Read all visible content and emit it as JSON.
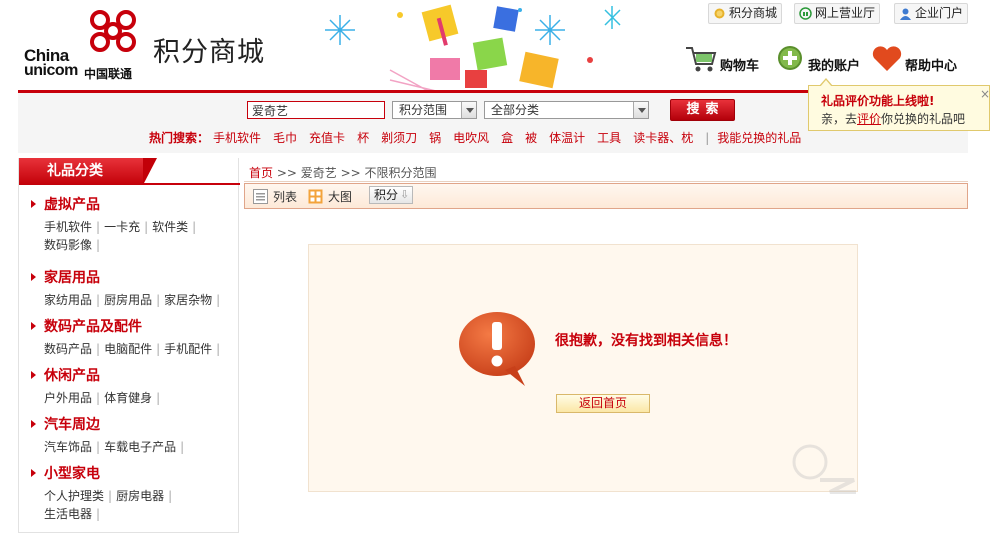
{
  "brand": {
    "china": "China",
    "unicom": "unicom",
    "name_cn": "中国联通",
    "site_title": "积分商城",
    "primary_color": "#c7000b"
  },
  "top_links": [
    {
      "label": "积分商城",
      "icon": "coins-icon"
    },
    {
      "label": "网上营业厅",
      "icon": "headset-icon"
    },
    {
      "label": "企业门户",
      "icon": "user-icon"
    }
  ],
  "nav": {
    "cart": "购物车",
    "account": "我的账户",
    "help": "帮助中心"
  },
  "tooltip": {
    "title": "礼品评价功能上线啦!",
    "prefix": "亲，去",
    "link": "评价",
    "suffix": "你兑换的礼品吧",
    "close": "×"
  },
  "search": {
    "value": "爱奇艺",
    "scope": "积分范围",
    "category": "全部分类",
    "button": "搜索"
  },
  "hot": {
    "label": "热门搜索：",
    "keywords": [
      "手机软件",
      "毛巾",
      "充值卡",
      "杯",
      "剃须刀",
      "锅",
      "电吹风",
      "盒",
      "被",
      "体温计",
      "工具",
      "读卡器、枕"
    ],
    "redeemable": "我能兑换的礼品"
  },
  "sidebar": {
    "title": "礼品分类",
    "categories": [
      {
        "name": "虚拟产品",
        "links": [
          "手机软件",
          "一卡充",
          "软件类",
          "数码影像"
        ]
      },
      {
        "name": "家居用品",
        "links": [
          "家纺用品",
          "厨房用品",
          "家居杂物"
        ]
      },
      {
        "name": "数码产品及配件",
        "links": [
          "数码产品",
          "电脑配件",
          "手机配件"
        ]
      },
      {
        "name": "休闲产品",
        "links": [
          "户外用品",
          "体育健身"
        ]
      },
      {
        "name": "汽车周边",
        "links": [
          "汽车饰品",
          "车载电子产品"
        ]
      },
      {
        "name": "小型家电",
        "links": [
          "个人护理类",
          "厨房电器",
          "生活电器"
        ]
      }
    ]
  },
  "breadcrumb": {
    "home": "首页",
    "sep": " >> ",
    "keyword": "爱奇艺",
    "scope": "不限积分范围"
  },
  "view": {
    "list": "列表",
    "grid": "大图",
    "sort": "积分"
  },
  "result": {
    "message": "很抱歉，没有找到相关信息！",
    "back": "返回首页"
  }
}
